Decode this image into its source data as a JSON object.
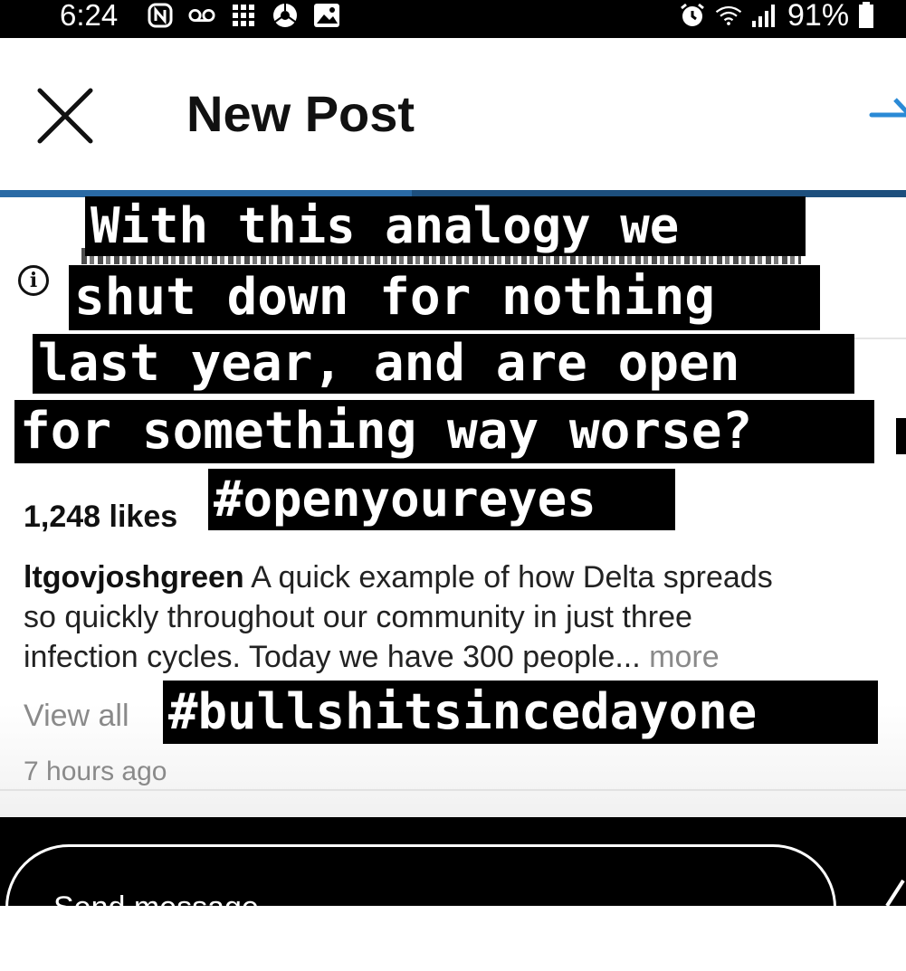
{
  "status_bar": {
    "time": "6:24",
    "battery": "91%",
    "icons_left": [
      "n-icon",
      "voicemail-icon",
      "grid-icon",
      "chrome-icon",
      "image-icon"
    ],
    "icons_right": [
      "alarm-icon",
      "wifi-icon",
      "signal-icon",
      "battery-icon"
    ]
  },
  "header": {
    "title": "New Post",
    "close_icon": "close-icon",
    "next_icon": "arrow-right-icon",
    "accent": "#2a6aa5"
  },
  "post": {
    "likes": "1,248 likes",
    "username": "ltgovjoshgreen",
    "caption_line1": " A quick example of how Delta spreads",
    "caption_line2": "so quickly throughout our community in just three",
    "caption_line3": "infection cycles. Today we have 300 people...",
    "more": "more",
    "view_all": "View all",
    "time_ago": "7 hours ago"
  },
  "overlay_text": {
    "line1": "With this analogy we",
    "line2": "shut down for nothing",
    "line3": "last year, and are open",
    "line4": "for something way worse?",
    "hashtag1": "#openyoureyes",
    "hashtag2": "#bullshitsincedayone"
  },
  "message_bar": {
    "placeholder": "Send message"
  }
}
